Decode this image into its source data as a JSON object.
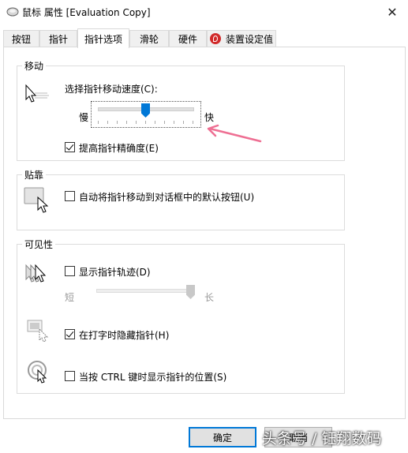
{
  "window": {
    "title": "鼠标 属性 [Evaluation Copy]"
  },
  "tabs": [
    {
      "label": "按钮"
    },
    {
      "label": "指针"
    },
    {
      "label": "指针选项",
      "active": true
    },
    {
      "label": "滑轮"
    },
    {
      "label": "硬件"
    },
    {
      "label": "装置设定值"
    }
  ],
  "motion": {
    "group_title": "移动",
    "speed_label": "选择指针移动速度(C):",
    "slow_label": "慢",
    "fast_label": "快",
    "speed_level": 0.5,
    "enhance_precision_label": "提高指针精确度(E)",
    "enhance_precision_checked": true
  },
  "snap": {
    "group_title": "贴靠",
    "snap_label": "自动将指针移动到对话框中的默认按钮(U)",
    "snap_checked": false
  },
  "visibility": {
    "group_title": "可见性",
    "trails_label": "显示指针轨迹(D)",
    "trails_checked": false,
    "short_label": "短",
    "long_label": "长",
    "trail_level": 1.0,
    "hide_typing_label": "在打字时隐藏指针(H)",
    "hide_typing_checked": true,
    "ctrl_show_label": "当按 CTRL 键时显示指针的位置(S)",
    "ctrl_show_checked": false
  },
  "buttons": {
    "ok_label": "确定",
    "cancel_label": "取消"
  },
  "watermark": {
    "text": "头条号 / 钰翔数码"
  },
  "colors": {
    "accent": "#0078d7",
    "annotation_arrow": "#ee6f93"
  }
}
